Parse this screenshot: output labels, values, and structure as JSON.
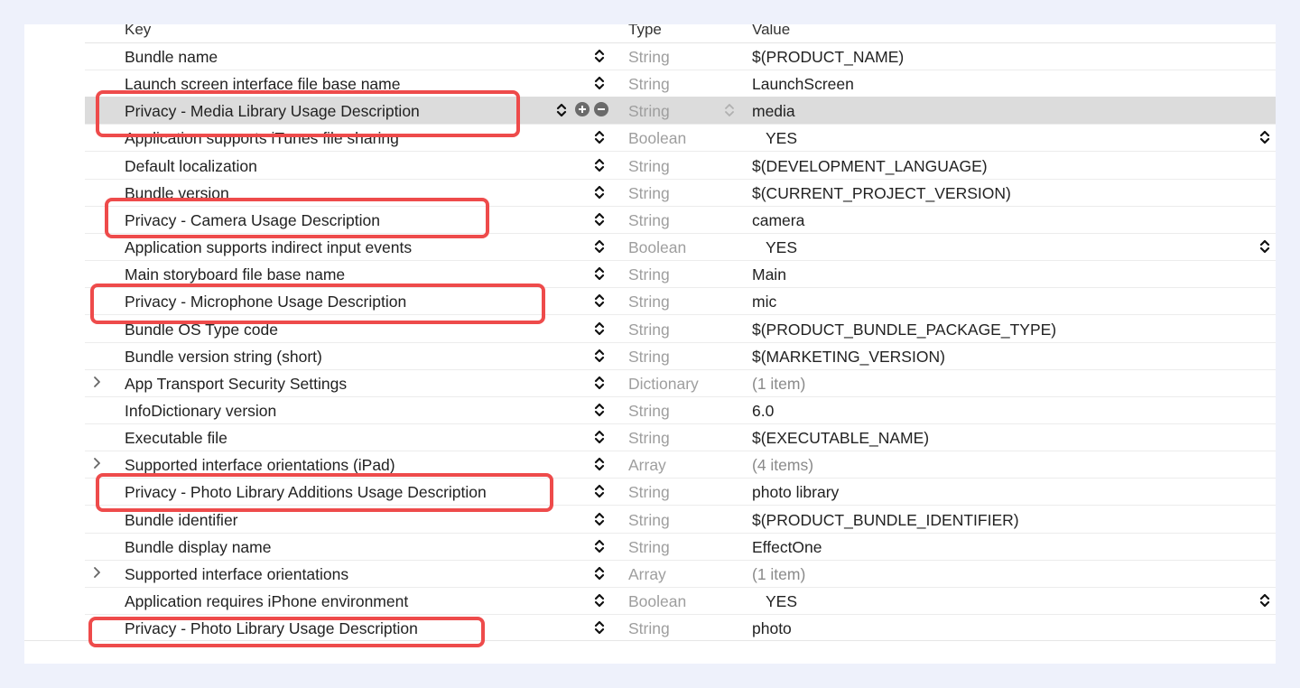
{
  "header": {
    "key_label": "Key",
    "type_label": "Type",
    "value_label": "Value"
  },
  "rows": [
    {
      "key": "Bundle name",
      "type": "String",
      "value": "$(PRODUCT_NAME)",
      "has_disclosure": false,
      "is_bool": false
    },
    {
      "key": "Launch screen interface file base name",
      "type": "String",
      "value": "LaunchScreen",
      "has_disclosure": false,
      "is_bool": false
    },
    {
      "key": "Privacy - Media Library Usage Description",
      "type": "String",
      "value": "media",
      "has_disclosure": false,
      "is_bool": false,
      "selected": true
    },
    {
      "key": "Application supports iTunes file sharing",
      "type": "Boolean",
      "value": "YES",
      "has_disclosure": false,
      "is_bool": true
    },
    {
      "key": "Default localization",
      "type": "String",
      "value": "$(DEVELOPMENT_LANGUAGE)",
      "has_disclosure": false,
      "is_bool": false
    },
    {
      "key": "Bundle version",
      "type": "String",
      "value": "$(CURRENT_PROJECT_VERSION)",
      "has_disclosure": false,
      "is_bool": false
    },
    {
      "key": "Privacy - Camera Usage Description",
      "type": "String",
      "value": "camera",
      "has_disclosure": false,
      "is_bool": false
    },
    {
      "key": "Application supports indirect input events",
      "type": "Boolean",
      "value": "YES",
      "has_disclosure": false,
      "is_bool": true
    },
    {
      "key": "Main storyboard file base name",
      "type": "String",
      "value": "Main",
      "has_disclosure": false,
      "is_bool": false
    },
    {
      "key": "Privacy - Microphone Usage Description",
      "type": "String",
      "value": "mic",
      "has_disclosure": false,
      "is_bool": false
    },
    {
      "key": "Bundle OS Type code",
      "type": "String",
      "value": "$(PRODUCT_BUNDLE_PACKAGE_TYPE)",
      "has_disclosure": false,
      "is_bool": false
    },
    {
      "key": "Bundle version string (short)",
      "type": "String",
      "value": "$(MARKETING_VERSION)",
      "has_disclosure": false,
      "is_bool": false
    },
    {
      "key": "App Transport Security Settings",
      "type": "Dictionary",
      "value": "(1 item)",
      "has_disclosure": true,
      "is_bool": false,
      "muted": true
    },
    {
      "key": "InfoDictionary version",
      "type": "String",
      "value": "6.0",
      "has_disclosure": false,
      "is_bool": false
    },
    {
      "key": "Executable file",
      "type": "String",
      "value": "$(EXECUTABLE_NAME)",
      "has_disclosure": false,
      "is_bool": false
    },
    {
      "key": "Supported interface orientations (iPad)",
      "type": "Array",
      "value": "(4 items)",
      "has_disclosure": true,
      "is_bool": false,
      "muted": true
    },
    {
      "key": "Privacy - Photo Library Additions Usage Description",
      "type": "String",
      "value": "photo library",
      "has_disclosure": false,
      "is_bool": false
    },
    {
      "key": "Bundle identifier",
      "type": "String",
      "value": "$(PRODUCT_BUNDLE_IDENTIFIER)",
      "has_disclosure": false,
      "is_bool": false
    },
    {
      "key": "Bundle display name",
      "type": "String",
      "value": "EffectOne",
      "has_disclosure": false,
      "is_bool": false
    },
    {
      "key": "Supported interface orientations",
      "type": "Array",
      "value": "(1 item)",
      "has_disclosure": true,
      "is_bool": false,
      "muted": true
    },
    {
      "key": "Application requires iPhone environment",
      "type": "Boolean",
      "value": "YES",
      "has_disclosure": false,
      "is_bool": true
    },
    {
      "key": "Privacy - Photo Library Usage Description",
      "type": "String",
      "value": "photo",
      "has_disclosure": false,
      "is_bool": false
    }
  ],
  "colors": {
    "highlight": "#ee4b4b",
    "selected_row": "#dcdcdc",
    "type_text": "#9e9e9e"
  },
  "icons": {
    "disclosure": "chevron-right-icon",
    "stepper": "up-down-stepper-icon",
    "add": "plus-circle-icon",
    "remove": "minus-circle-icon"
  }
}
